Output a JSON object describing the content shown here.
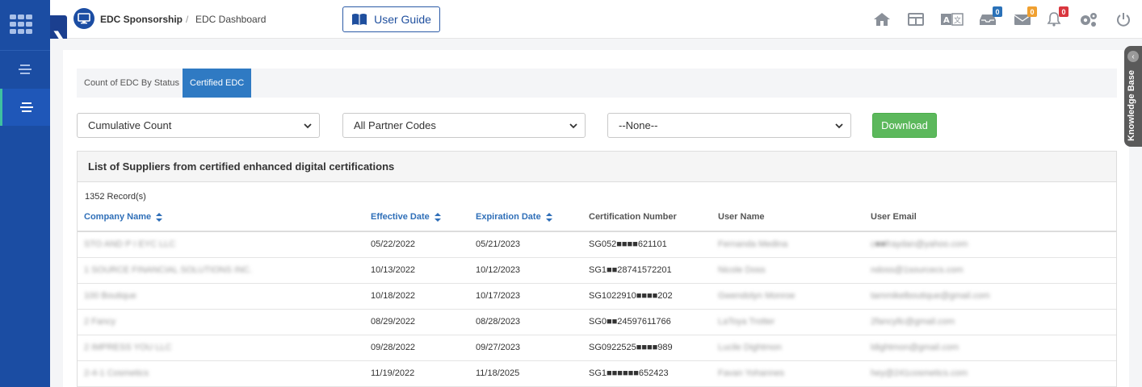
{
  "header": {
    "crumb_primary": "EDC Sponsorship",
    "crumb_separator": "/",
    "crumb_secondary": "EDC Dashboard",
    "user_guide_label": "User Guide",
    "notifications": {
      "inbox_count": "0",
      "messages_count": "0",
      "alerts_count": "0"
    }
  },
  "tabs": [
    {
      "label": "Count of EDC By Status",
      "active": false
    },
    {
      "label": "Certified EDC",
      "active": true
    }
  ],
  "filters": {
    "count_type": "Cumulative Count",
    "partner_codes": "All Partner Codes",
    "third": "--None--",
    "download_label": "Download"
  },
  "panel": {
    "title": "List of Suppliers from certified enhanced digital certifications",
    "records": "1352 Record(s)"
  },
  "table": {
    "columns": [
      "Company Name",
      "Effective Date",
      "Expiration Date",
      "Certification Number",
      "User Name",
      "User Email"
    ],
    "rows": [
      {
        "company": "STO AND P I EYC LLC",
        "effective": "05/22/2022",
        "expiration": "05/21/2023",
        "cert": "SG052■■■■621101",
        "user": "Fernanda Medina",
        "email": "c■■fraydan@yahoo.com"
      },
      {
        "company": "1 SOURCE FINANCIAL SOLUTIONS INC.",
        "effective": "10/13/2022",
        "expiration": "10/12/2023",
        "cert": "SG1■■28741572201",
        "user": "Nicole Doss",
        "email": "ndoss@1sourcecs.com"
      },
      {
        "company": "100 Boutique",
        "effective": "10/18/2022",
        "expiration": "10/17/2023",
        "cert": "SG1022910■■■■202",
        "user": "Gwendolyn Monroe",
        "email": "tammikelboutique@gmail.com"
      },
      {
        "company": "2 Fancy",
        "effective": "08/29/2022",
        "expiration": "08/28/2023",
        "cert": "SG0■■24597611766",
        "user": "LaToya Trotter",
        "email": "2fancyllc@gmail.com"
      },
      {
        "company": "2 IMPRESS YOU LLC",
        "effective": "09/28/2022",
        "expiration": "09/27/2023",
        "cert": "SG0922525■■■■989",
        "user": "Lucile Dightmon",
        "email": "ldightmon@gmail.com"
      },
      {
        "company": "2-4-1 Cosmetics",
        "effective": "11/19/2022",
        "expiration": "11/18/2025",
        "cert": "SG1■■■■■■652423",
        "user": "Favan Yohannes",
        "email": "hey@241cosmetics.com"
      }
    ]
  },
  "knowledge_base_label": "Knowledge Base",
  "colors": {
    "rail": "#1b4da3",
    "tab_active": "#2f7ac3",
    "download": "#5cb85c",
    "link": "#2f6fb8"
  }
}
